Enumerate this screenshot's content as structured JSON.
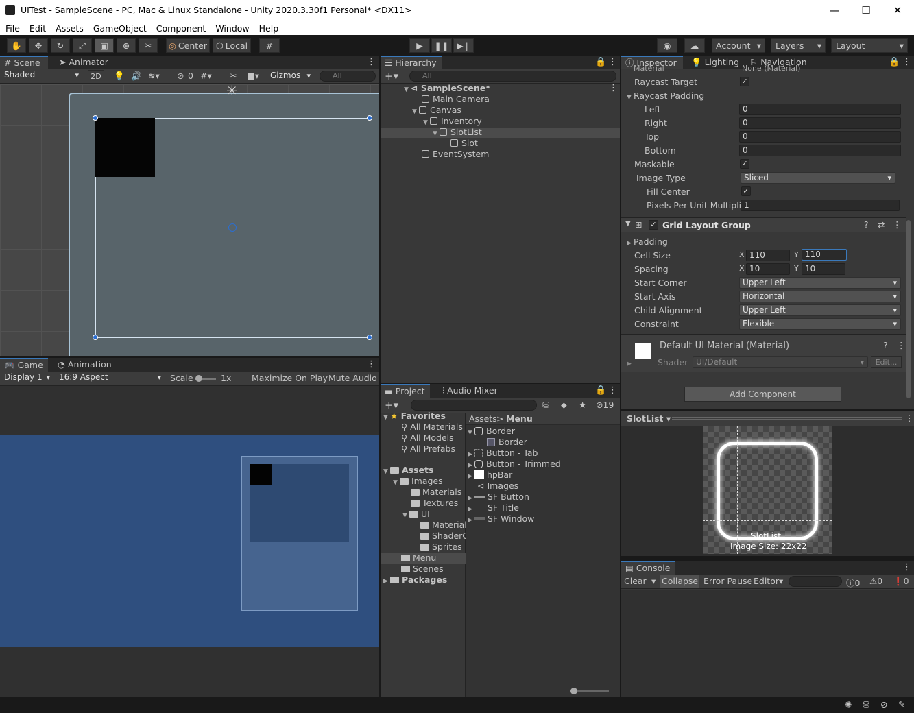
{
  "window": {
    "title": "UITest - SampleScene - PC, Mac & Linux Standalone - Unity 2020.3.30f1 Personal* <DX11>",
    "minimize": "—",
    "maximize": "☐",
    "close": "✕"
  },
  "menu": [
    "File",
    "Edit",
    "Assets",
    "GameObject",
    "Component",
    "Window",
    "Help"
  ],
  "toolbar": {
    "center": "Center",
    "local": "Local",
    "account": "Account",
    "layers": "Layers",
    "layout": "Layout"
  },
  "scene": {
    "tab_scene": "Scene",
    "tab_animator": "Animator",
    "shading": "Shaded",
    "mode_2d": "2D",
    "hidden_count": "0",
    "gizmos": "Gizmos",
    "search_placeholder": "All"
  },
  "game": {
    "tab_game": "Game",
    "tab_animation": "Animation",
    "display": "Display 1",
    "aspect": "16:9 Aspect",
    "scale_label": "Scale",
    "scale_value": "1x",
    "maximize": "Maximize On Play",
    "mute": "Mute Audio"
  },
  "hierarchy": {
    "tab": "Hierarchy",
    "search_placeholder": "All",
    "items": [
      {
        "label": "SampleScene*",
        "indent": 0
      },
      {
        "label": "Main Camera",
        "indent": 1
      },
      {
        "label": "Canvas",
        "indent": 1
      },
      {
        "label": "Inventory",
        "indent": 2
      },
      {
        "label": "SlotList",
        "indent": 3
      },
      {
        "label": "Slot",
        "indent": 4
      },
      {
        "label": "EventSystem",
        "indent": 1
      }
    ]
  },
  "project": {
    "tab_project": "Project",
    "tab_audio": "Audio Mixer",
    "hidden_count": "19",
    "favorites": "Favorites",
    "fav_items": [
      "All Materials",
      "All Models",
      "All Prefabs"
    ],
    "assets": "Assets",
    "tree": [
      "Images",
      "Materials",
      "Textures",
      "UI",
      "Materials",
      "ShaderG",
      "Sprites",
      "Menu",
      "Scenes"
    ],
    "packages": "Packages",
    "breadcrumb": [
      "Assets",
      "Menu"
    ],
    "files": [
      "Border",
      "Border",
      "Button - Tab",
      "Button - Trimmed",
      "hpBar",
      "Images",
      "SF Button",
      "SF Title",
      "SF Window"
    ]
  },
  "inspector": {
    "tab_inspector": "Inspector",
    "tab_lighting": "Lighting",
    "tab_navigation": "Navigation",
    "material_label": "Material",
    "material_value": "None (Material)",
    "raycast_target": "Raycast Target",
    "raycast_padding": "Raycast Padding",
    "left": "Left",
    "left_v": "0",
    "right": "Right",
    "right_v": "0",
    "top": "Top",
    "top_v": "0",
    "bottom": "Bottom",
    "bottom_v": "0",
    "maskable": "Maskable",
    "image_type": "Image Type",
    "image_type_v": "Sliced",
    "fill_center": "Fill Center",
    "ppu": "Pixels Per Unit Multiplier",
    "ppu_v": "1",
    "grid": "Grid Layout Group",
    "padding": "Padding",
    "cell_size": "Cell Size",
    "cell_x": "110",
    "cell_y": "110",
    "spacing": "Spacing",
    "spacing_x": "10",
    "spacing_y": "10",
    "x": "X",
    "y": "Y",
    "start_corner": "Start Corner",
    "start_corner_v": "Upper Left",
    "start_axis": "Start Axis",
    "start_axis_v": "Horizontal",
    "child_alignment": "Child Alignment",
    "child_alignment_v": "Upper Left",
    "constraint": "Constraint",
    "constraint_v": "Flexible",
    "mat_name": "Default UI Material (Material)",
    "shader": "Shader",
    "shader_v": "UI/Default",
    "edit": "Edit...",
    "add_component": "Add Component"
  },
  "preview": {
    "title": "SlotList",
    "caption1": "SlotList",
    "caption2": "Image Size: 22x22"
  },
  "console": {
    "tab": "Console",
    "clear": "Clear",
    "collapse": "Collapse",
    "error_pause": "Error Pause",
    "editor": "Editor",
    "info": "0",
    "warn": "0",
    "err": "0"
  }
}
